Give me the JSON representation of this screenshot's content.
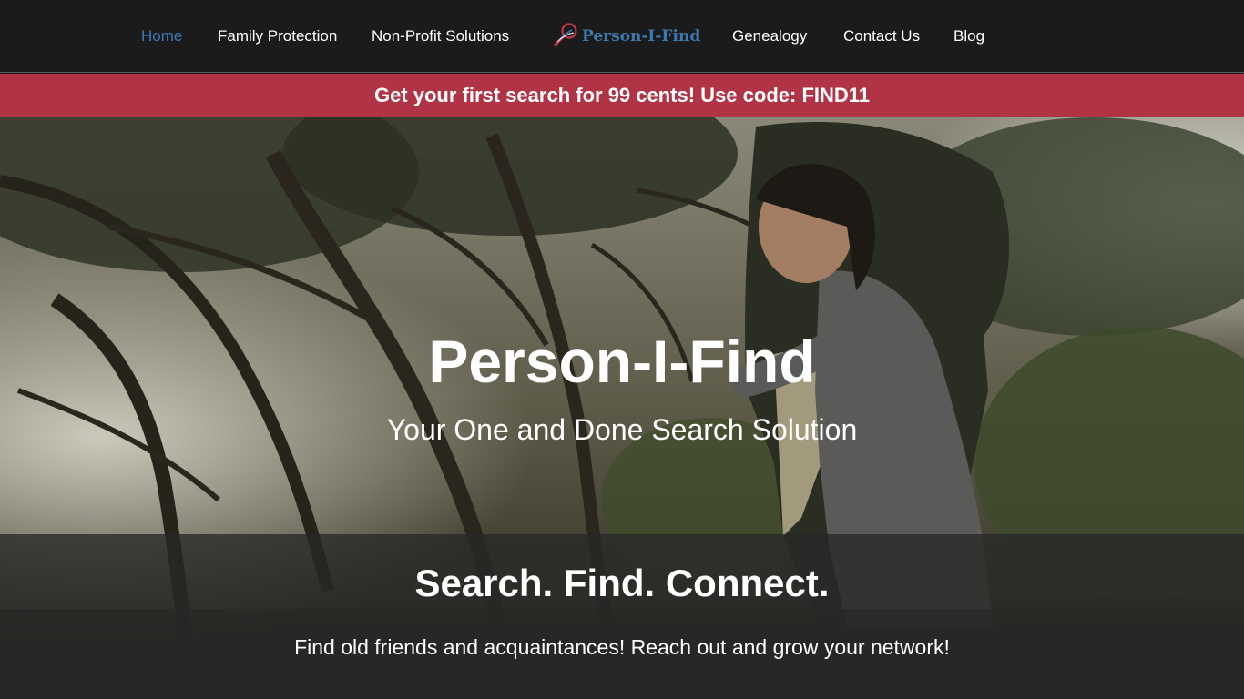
{
  "nav": {
    "items_left": [
      {
        "label": "Home",
        "active": true
      },
      {
        "label": "Family Protection",
        "active": false
      },
      {
        "label": "Non-Profit Solutions",
        "active": false
      }
    ],
    "logo": {
      "text": "Person-I-Find",
      "icon": "magnifier-icon"
    },
    "items_right": [
      {
        "label": "Genealogy",
        "active": false
      },
      {
        "label": "Contact Us",
        "active": false
      },
      {
        "label": "Blog",
        "active": false
      }
    ]
  },
  "promo": {
    "text": "Get your first search for 99 cents! Use code: FIND11"
  },
  "hero": {
    "title": "Person-I-Find",
    "subtitle": "Your One and Done Search Solution"
  },
  "band": {
    "title": "Search. Find. Connect.",
    "text": "Find old friends and acquaintances! Reach out and grow your network!"
  },
  "colors": {
    "nav_bg": "#1b1b1b",
    "active_link": "#3d79b0",
    "promo_bg": "#b13446",
    "logo_accent": "#c2364a"
  }
}
